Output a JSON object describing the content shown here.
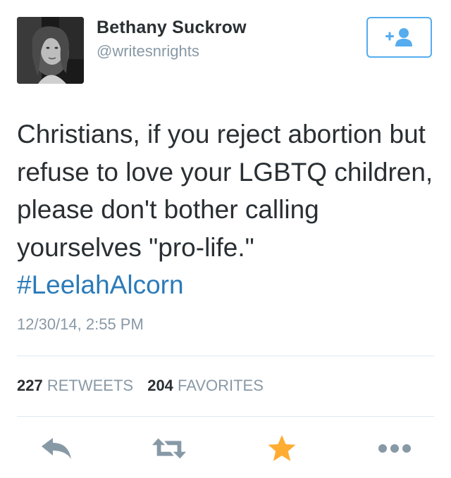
{
  "author": {
    "name": "Bethany Suckrow",
    "handle": "@writesnrights"
  },
  "follow_button": {
    "icon": "add-user-icon",
    "accent_color": "#55acee"
  },
  "tweet": {
    "text": "Christians, if you reject abortion but refuse to love your LGBTQ children, please don't bother calling yourselves \"pro-life.\"",
    "hashtag": "#LeelahAlcorn",
    "timestamp": "12/30/14, 2:55 PM"
  },
  "stats": {
    "retweets_count": "227",
    "retweets_label": "RETWEETS",
    "favorites_count": "204",
    "favorites_label": "FAVORITES"
  },
  "actions": [
    {
      "icon": "reply-icon",
      "color": "#8899a6"
    },
    {
      "icon": "retweet-icon",
      "color": "#8899a6"
    },
    {
      "icon": "favorite-star-icon",
      "color": "#ffac33"
    },
    {
      "icon": "more-options-icon",
      "color": "#8899a6"
    }
  ],
  "colors": {
    "text": "#292f33",
    "muted": "#8899a6",
    "link": "#2b7bb9",
    "divider": "#e1e8ed"
  }
}
